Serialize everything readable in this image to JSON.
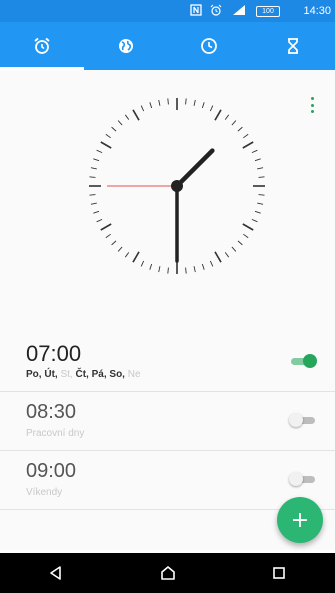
{
  "status_bar": {
    "time": "14:30",
    "battery": "100",
    "icons": [
      "nfc-icon",
      "alarm-icon",
      "signal-icon",
      "battery-icon"
    ]
  },
  "tabs": [
    {
      "name": "alarm-clock-icon",
      "active": true
    },
    {
      "name": "world-clock-icon",
      "active": false
    },
    {
      "name": "clock-icon",
      "active": false
    },
    {
      "name": "hourglass-icon",
      "active": false
    }
  ],
  "clock": {
    "hour": 1,
    "minute": 30,
    "second": 45
  },
  "alarms": [
    {
      "time": "07:00",
      "enabled": true,
      "days": [
        {
          "label": "Po,",
          "on": true
        },
        {
          "label": "Út,",
          "on": true
        },
        {
          "label": "St,",
          "on": false
        },
        {
          "label": "Čt,",
          "on": true
        },
        {
          "label": "Pá,",
          "on": true
        },
        {
          "label": "So,",
          "on": true
        },
        {
          "label": "Ne",
          "on": false
        }
      ]
    },
    {
      "time": "08:30",
      "enabled": false,
      "subtitle": "Pracovní dny"
    },
    {
      "time": "09:00",
      "enabled": false,
      "subtitle": "Víkendy"
    }
  ],
  "fab_label": "+",
  "colors": {
    "accent": "#2196f3",
    "status_bar": "#1e88e5",
    "toggle_on": "#26a65b",
    "fab": "#2bb673"
  }
}
